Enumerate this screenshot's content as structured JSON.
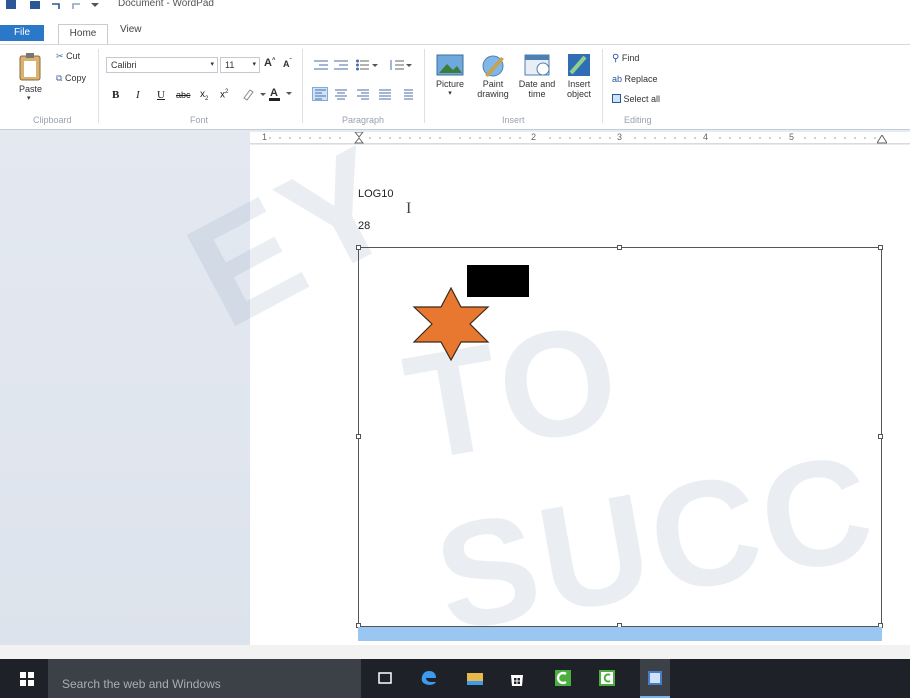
{
  "app": {
    "title": "Document - WordPad"
  },
  "tabs": {
    "file": "File",
    "home": "Home",
    "view": "View"
  },
  "clipboard": {
    "paste": "Paste",
    "cut": "Cut",
    "copy": "Copy",
    "label": "Clipboard"
  },
  "font": {
    "family": "Calibri",
    "size": "11",
    "label": "Font"
  },
  "paragraph": {
    "label": "Paragraph"
  },
  "insert": {
    "picture": "Picture",
    "paint_drawing": [
      "Paint",
      "drawing"
    ],
    "date_time": [
      "Date and",
      "time"
    ],
    "insert_object": [
      "Insert",
      "object"
    ],
    "label": "Insert"
  },
  "editing": {
    "find": "Find",
    "replace": "Replace",
    "select_all": "Select all",
    "label": "Editing"
  },
  "ruler": {
    "numbers": [
      "1",
      "2",
      "3",
      "4",
      "5"
    ]
  },
  "document": {
    "line1": "LOG10",
    "line2": "28"
  },
  "watermark": {
    "text1": "EY",
    "text2": "TO SUCC"
  },
  "taskbar": {
    "search_placeholder": "Search the web and Windows"
  },
  "colors": {
    "accent": "#2b78c9",
    "star_fill": "#e8782f",
    "selection": "#99c7f2",
    "taskbar": "#1e2127"
  }
}
